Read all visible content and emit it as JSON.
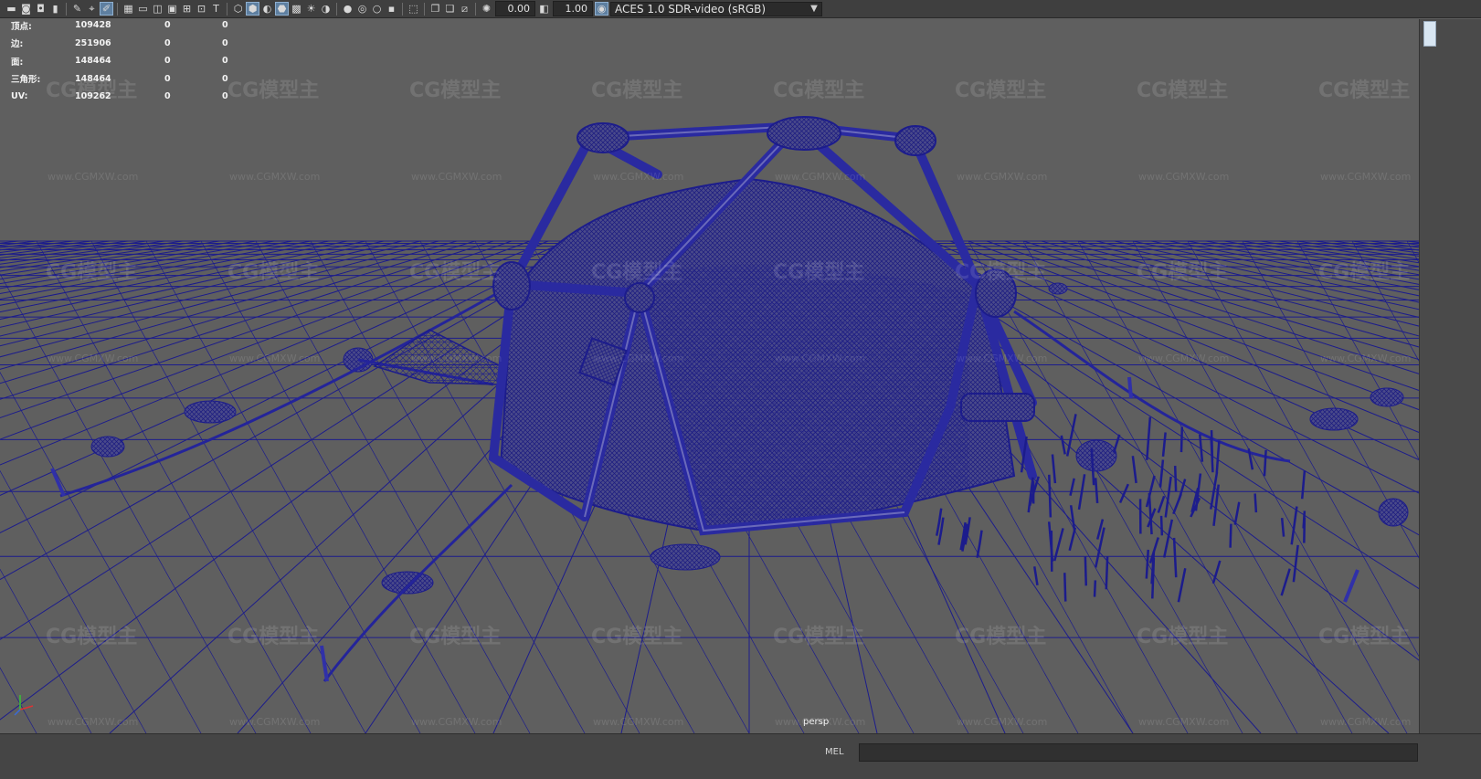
{
  "toolbar": {
    "icons": [
      "camera-icon",
      "camera-attr-icon",
      "bookmark-icon",
      "image-plane-icon",
      "grid-icon",
      "film-gate-icon",
      "resolution-gate-icon",
      "gate-mask-icon",
      "field-chart-icon",
      "safe-action-icon",
      "safe-title-icon",
      "wireframe-icon",
      "smooth-shade-icon",
      "default-material-icon",
      "textured-icon",
      "lights-icon",
      "shadows-icon",
      "ao-icon",
      "motion-blur-icon",
      "aa-icon",
      "depth-of-field-icon",
      "isolate-select-icon",
      "xray-icon",
      "xray-joints-icon",
      "xray-components-icon",
      "exposure-icon",
      "gamma-icon",
      "color-management-icon"
    ],
    "exposure": "0.00",
    "gamma": "1.00",
    "color_space": "ACES 1.0 SDR-video (sRGB)"
  },
  "hud": {
    "rows": [
      {
        "label": "顶点:",
        "a": "109428",
        "b": "0",
        "c": "0"
      },
      {
        "label": "边:",
        "a": "251906",
        "b": "0",
        "c": "0"
      },
      {
        "label": "面:",
        "a": "148464",
        "b": "0",
        "c": "0"
      },
      {
        "label": "三角形:",
        "a": "148464",
        "b": "0",
        "c": "0"
      },
      {
        "label": "UV:",
        "a": "109262",
        "b": "0",
        "c": "0"
      }
    ]
  },
  "viewport": {
    "camera_label": "persp",
    "watermark_text": "CG模型主",
    "watermark_url": "www.CGMXW.com",
    "wire_color": "#1c1c8c",
    "bg_color": "#5f5f5f"
  },
  "statusbar": {
    "mel_label": "MEL"
  }
}
